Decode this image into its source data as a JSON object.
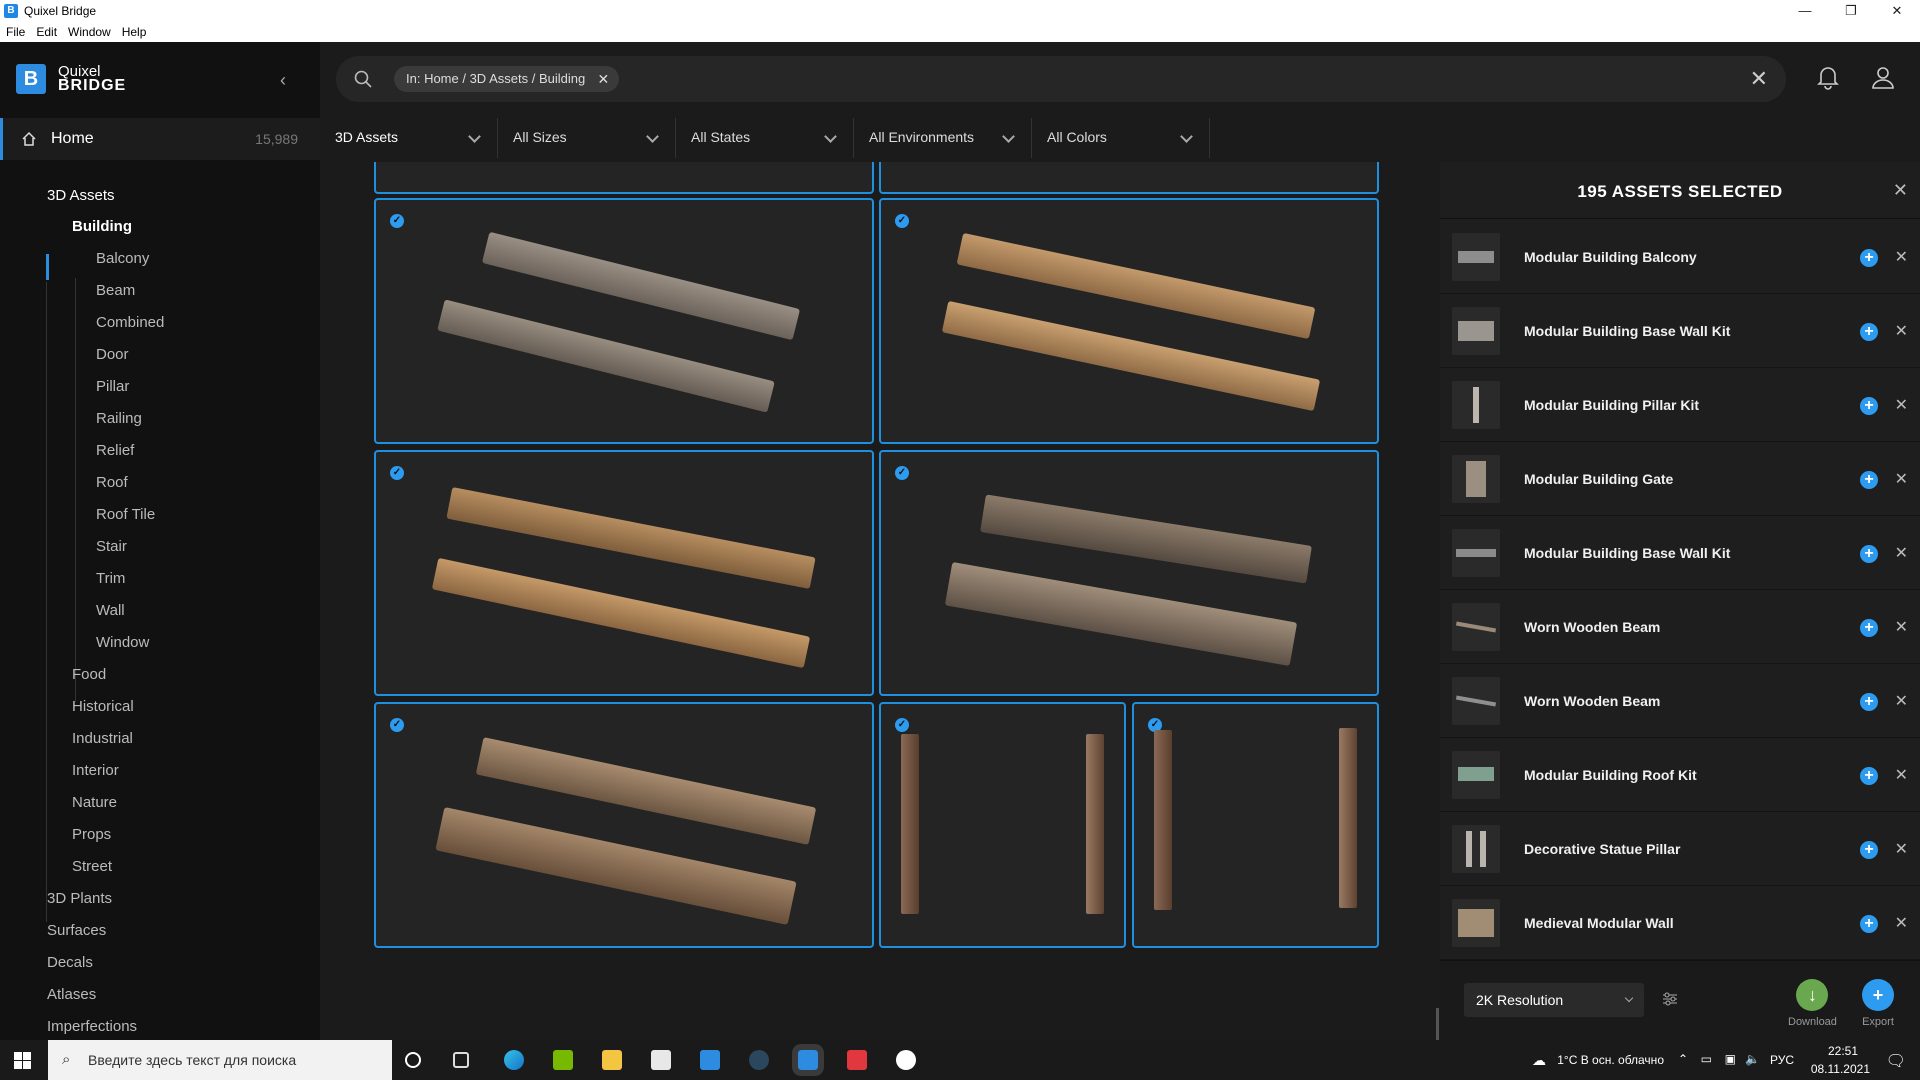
{
  "window": {
    "title": "Quixel Bridge",
    "controls": [
      "—",
      "❐",
      "✕"
    ]
  },
  "menu": [
    "File",
    "Edit",
    "Window",
    "Help"
  ],
  "brand": {
    "line1": "Quixel",
    "line2": "BRIDGE",
    "logo_letter": "B"
  },
  "sidebar": {
    "home_label": "Home",
    "home_count": "15,989",
    "categories": [
      {
        "label": "3D Assets"
      },
      {
        "label": "Building"
      },
      {
        "label": "Balcony"
      },
      {
        "label": "Beam"
      },
      {
        "label": "Combined"
      },
      {
        "label": "Door"
      },
      {
        "label": "Pillar"
      },
      {
        "label": "Railing"
      },
      {
        "label": "Relief"
      },
      {
        "label": "Roof"
      },
      {
        "label": "Roof Tile"
      },
      {
        "label": "Stair"
      },
      {
        "label": "Trim"
      },
      {
        "label": "Wall"
      },
      {
        "label": "Window"
      },
      {
        "label": "Food"
      },
      {
        "label": "Historical"
      },
      {
        "label": "Industrial"
      },
      {
        "label": "Interior"
      },
      {
        "label": "Nature"
      },
      {
        "label": "Props"
      },
      {
        "label": "Street"
      },
      {
        "label": "3D Plants"
      },
      {
        "label": "Surfaces"
      },
      {
        "label": "Decals"
      },
      {
        "label": "Atlases"
      },
      {
        "label": "Imperfections"
      }
    ]
  },
  "search": {
    "chip": "In: Home / 3D Assets / Building",
    "chip_remove": "✕",
    "clear": "✕"
  },
  "filters": [
    "3D Assets",
    "All Sizes",
    "All States",
    "All Environments",
    "All Colors"
  ],
  "panel": {
    "title": "195 ASSETS SELECTED",
    "close": "✕",
    "items": [
      {
        "name": "Modular Building Balcony"
      },
      {
        "name": "Modular Building Base Wall Kit"
      },
      {
        "name": "Modular Building Pillar Kit"
      },
      {
        "name": "Modular Building Gate"
      },
      {
        "name": "Modular Building Base Wall Kit"
      },
      {
        "name": "Worn Wooden Beam"
      },
      {
        "name": "Worn Wooden Beam"
      },
      {
        "name": "Modular Building Roof Kit"
      },
      {
        "name": "Decorative Statue Pillar"
      },
      {
        "name": "Medieval Modular Wall"
      }
    ],
    "resolution": "2K Resolution",
    "download_label": "Download",
    "export_label": "Export"
  },
  "taskbar": {
    "search_placeholder": "Введите здесь текст для поиска",
    "weather": "1°C  В осн. облачно",
    "lang": "РУС",
    "time": "22:51",
    "date": "08.11.2021"
  },
  "colors": {
    "accent": "#2d9cf0",
    "download": "#6aa84f",
    "card_border": "#1f8fe0"
  }
}
